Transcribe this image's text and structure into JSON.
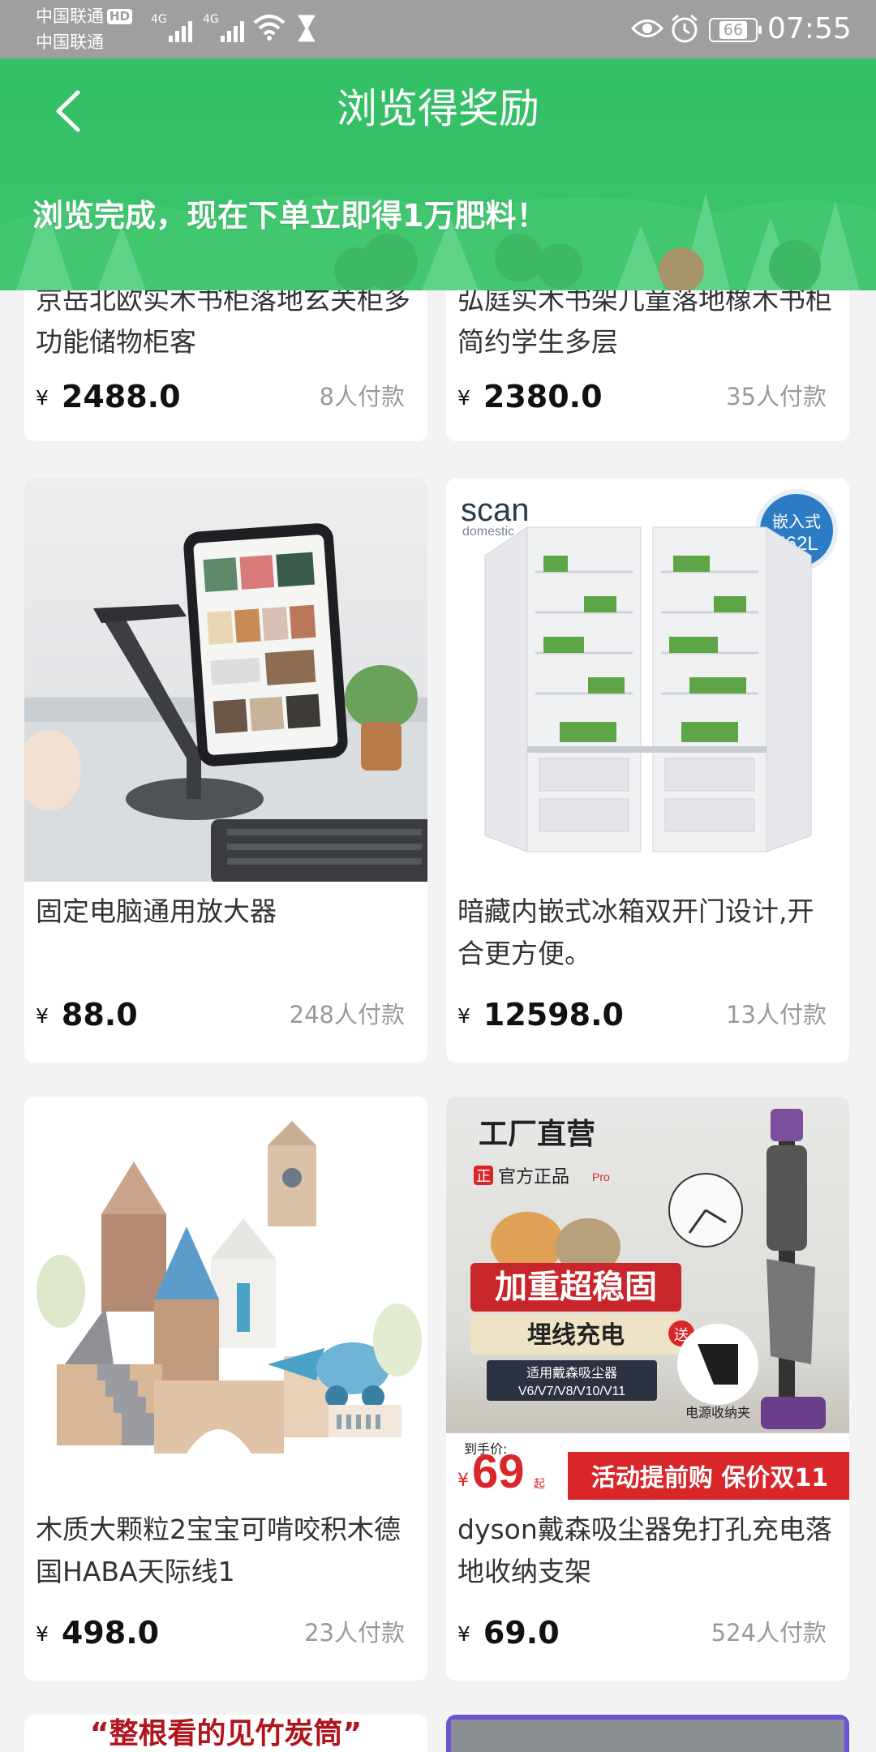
{
  "status_bar": {
    "carrier1": "中国联通",
    "hd_badge": "HD",
    "carrier2": "中国联通",
    "network1": "4G",
    "network2": "4G",
    "battery": "66",
    "time": "07:55"
  },
  "header": {
    "title": "浏览得奖励",
    "banner": "浏览完成，现在下单立即得1万肥料！"
  },
  "products": [
    {
      "title": "京岳北欧实木书柜落地玄关柜多功能储物柜客",
      "price": "2488.0",
      "sales": "8人付款",
      "currency": "¥"
    },
    {
      "title": "弘庭实木书架儿童落地橡木书柜简约学生多层",
      "price": "2380.0",
      "sales": "35人付款",
      "currency": "¥"
    },
    {
      "title": "固定电脑通用放大器",
      "price": "88.0",
      "sales": "248人付款",
      "currency": "¥"
    },
    {
      "title": "暗藏内嵌式冰箱双开门设计,开合更方便。",
      "price": "12598.0",
      "sales": "13人付款",
      "currency": "¥",
      "image_text": {
        "brand": "scan",
        "brand_sub": "domestic",
        "badge_line1": "嵌入式",
        "badge_line2": "562L"
      }
    },
    {
      "title": "木质大颗粒2宝宝可啃咬积木德国HABA天际线1",
      "price": "498.0",
      "sales": "23人付款",
      "currency": "¥"
    },
    {
      "title": "dyson戴森吸尘器免打孔充电落地收纳支架",
      "price": "69.0",
      "sales": "524人付款",
      "currency": "¥",
      "image_text": {
        "factory": "工厂直营",
        "genuine_mark": "正",
        "genuine": "官方正品",
        "pro": "Pro",
        "heavy": "加重超稳固",
        "wiring": "埋线充电",
        "compat_line1": "适用戴森吸尘器",
        "compat_line2": "V6/V7/V8/V10/V11",
        "gift": "送",
        "holder": "电源收纳夹",
        "handprice_label": "到手价:",
        "handprice_yen": "¥",
        "handprice": "69",
        "handprice_suffix": "起",
        "promo": "活动提前购 保价双11"
      }
    }
  ],
  "next_row": {
    "left_image_text": "“整根看的见竹炭筒”"
  }
}
